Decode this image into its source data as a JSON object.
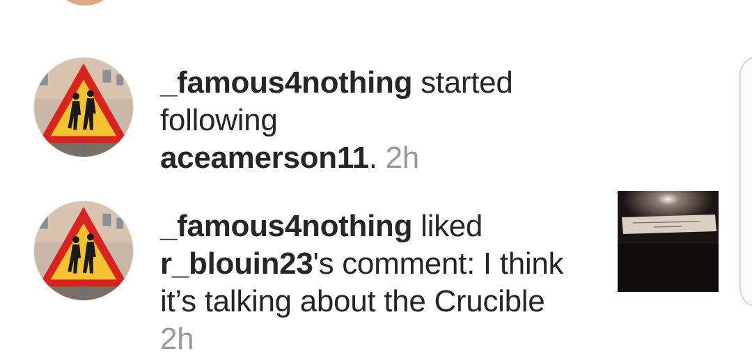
{
  "notifications": [
    {
      "username": "_famous4nothing",
      "action": " started following",
      "target": "aceamerson11",
      "suffix": ". ",
      "time": "2h",
      "avatar_icon": "pedestrian-warning-sign-icon"
    },
    {
      "username": "_famous4nothing",
      "action": " liked",
      "target": "r_blouin23",
      "suffix": "'s comment: I think it’s talking about the Crucible",
      "time": "2h",
      "avatar_icon": "pedestrian-warning-sign-icon",
      "thumbnail": "fortune-cookie-paper-photo"
    }
  ],
  "colors": {
    "text": "#262626",
    "muted": "#999999",
    "sign_red": "#d8231f",
    "sign_yellow": "#f2c230"
  }
}
